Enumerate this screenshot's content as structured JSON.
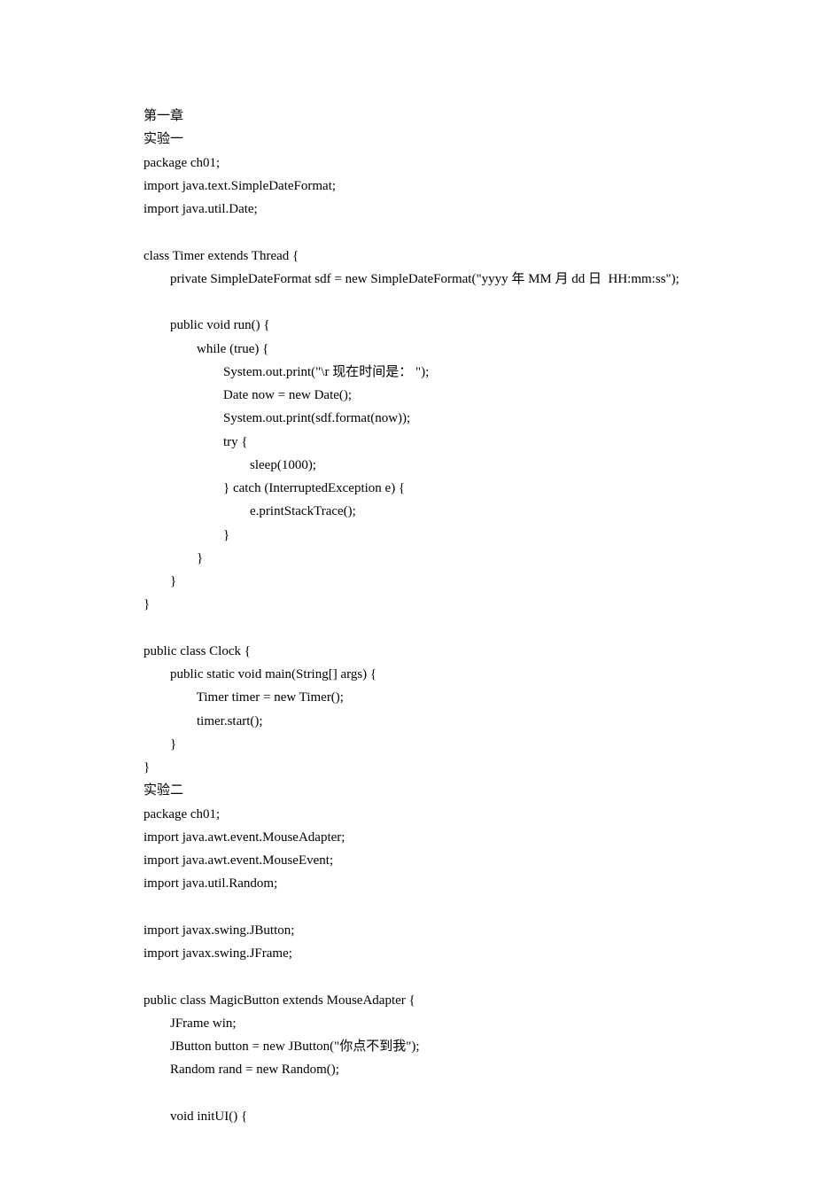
{
  "lines": [
    "第一章",
    "实验一",
    "package ch01;",
    "import java.text.SimpleDateFormat;",
    "import java.util.Date;",
    "",
    "class Timer extends Thread {",
    "        private SimpleDateFormat sdf = new SimpleDateFormat(\"yyyy 年 MM 月 dd 日  HH:mm:ss\");",
    "",
    "        public void run() {",
    "                while (true) {",
    "                        System.out.print(\"\\r 现在时间是： \");",
    "                        Date now = new Date();",
    "                        System.out.print(sdf.format(now));",
    "                        try {",
    "                                sleep(1000);",
    "                        } catch (InterruptedException e) {",
    "                                e.printStackTrace();",
    "                        }",
    "                }",
    "        }",
    "}",
    "",
    "public class Clock {",
    "        public static void main(String[] args) {",
    "                Timer timer = new Timer();",
    "                timer.start();",
    "        }",
    "}",
    "实验二",
    "package ch01;",
    "import java.awt.event.MouseAdapter;",
    "import java.awt.event.MouseEvent;",
    "import java.util.Random;",
    "",
    "import javax.swing.JButton;",
    "import javax.swing.JFrame;",
    "",
    "public class MagicButton extends MouseAdapter {",
    "        JFrame win;",
    "        JButton button = new JButton(\"你点不到我\");",
    "        Random rand = new Random();",
    "",
    "        void initUI() {"
  ]
}
